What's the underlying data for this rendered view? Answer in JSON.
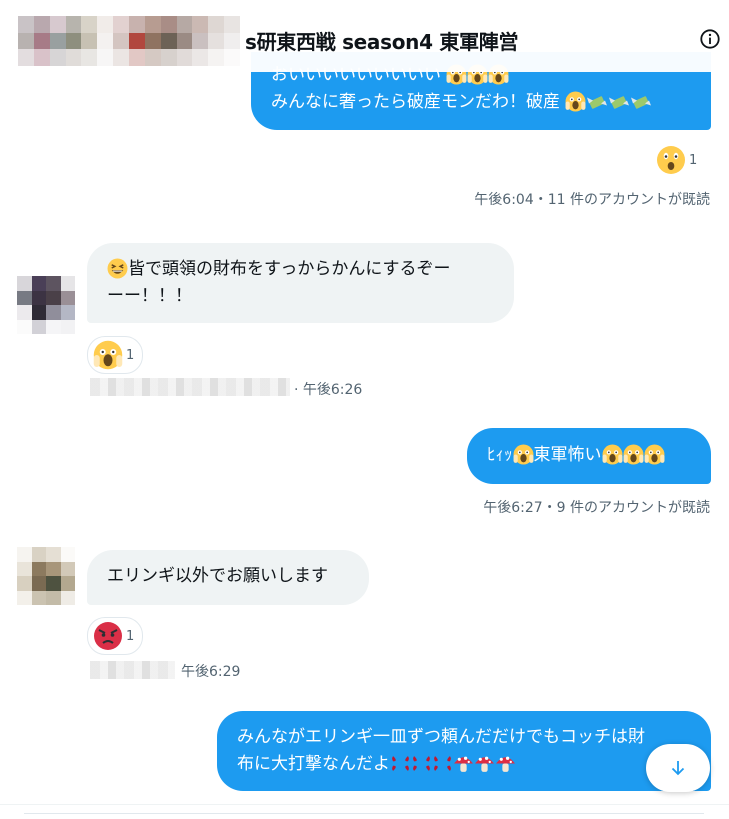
{
  "header": {
    "title": "s研東西戦 season4 東軍陣営"
  },
  "messages": {
    "m1": {
      "line1": "おいいいいいいいいい",
      "line2": "みんなに奢ったら破産モンだわ！破産"
    },
    "m1_reaction": {
      "emoji": "astonished-face",
      "count": "1"
    },
    "m1_meta": "午後6:04・11 件のアカウントが既読",
    "m2": {
      "line1": "皆で頭領の財布をすっからかんにするぞー",
      "line2": "ーー！！！"
    },
    "m2_reaction": {
      "emoji": "screaming-face",
      "count": "1"
    },
    "m2_meta": "· 午後6:26",
    "m3": {
      "prefix": "ﾋｨｯ",
      "text": "東軍怖い"
    },
    "m3_meta": "午後6:27・9 件のアカウントが既読",
    "m4": {
      "text": "エリンギ以外でお願いします"
    },
    "m4_reaction": {
      "emoji": "angry-face",
      "count": "1"
    },
    "m4_meta": "午後6:29",
    "m5": {
      "line1": "みんながエリンギ一皿ずつ頼んだだけでもコッチは財",
      "line2": "布に大打撃なんだよ"
    }
  },
  "colors": {
    "accent": "#1d9bf0",
    "incoming_bubble": "#eff3f4",
    "meta_text": "#536471"
  },
  "icons": {
    "info": "info-circle-icon",
    "scroll_down": "arrow-down-icon"
  }
}
